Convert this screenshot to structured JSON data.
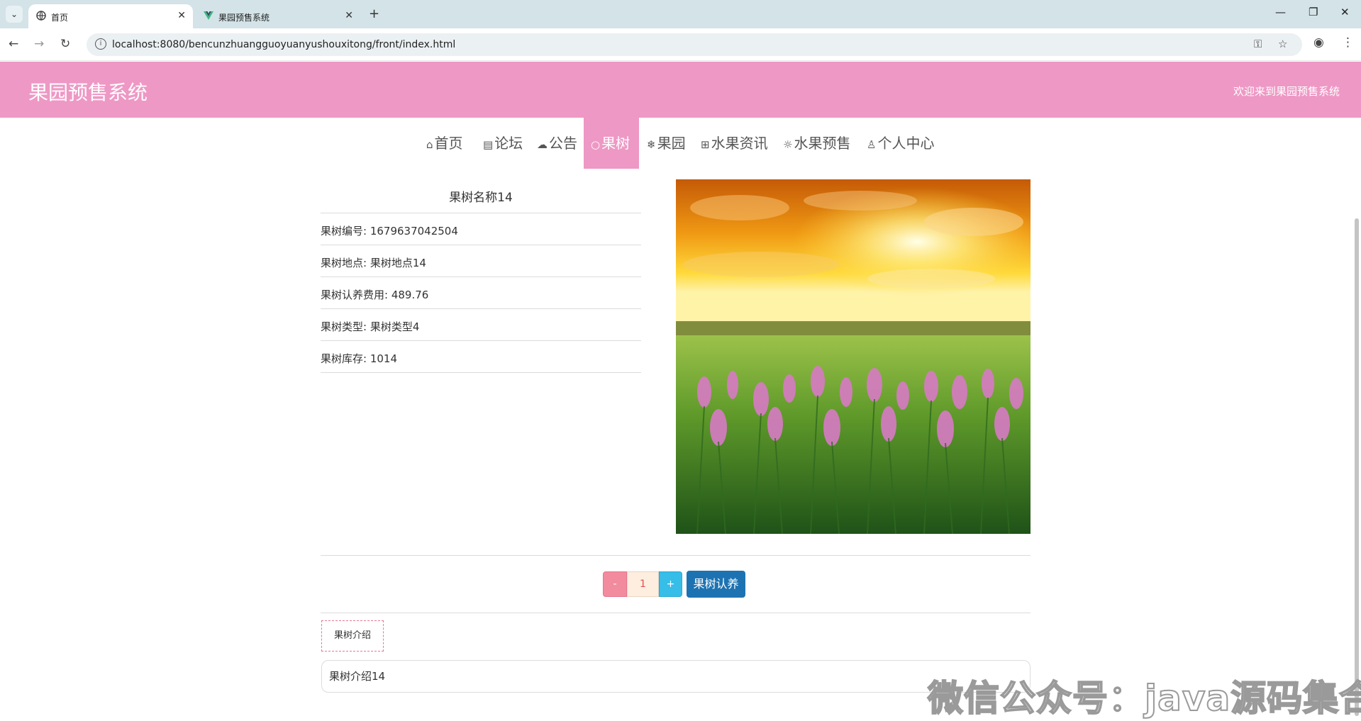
{
  "browser": {
    "tabs": [
      {
        "title": "首页",
        "icon": "globe-icon",
        "active": true
      },
      {
        "title": "果园预售系统",
        "icon": "vue-logo-icon",
        "active": false
      }
    ],
    "url": "localhost:8080/bencunzhuangguoyuanyushouxitong/front/index.html"
  },
  "header": {
    "title": "果园预售系统",
    "welcome": "欢迎来到果园预售系统"
  },
  "nav": {
    "items": [
      {
        "label": "首页",
        "icon": "home-icon"
      },
      {
        "label": "论坛",
        "icon": "calendar-icon"
      },
      {
        "label": "公告",
        "icon": "palette-icon"
      },
      {
        "label": "果树",
        "icon": "circle-icon",
        "active": true
      },
      {
        "label": "果园",
        "icon": "snowflake-icon"
      },
      {
        "label": "水果资讯",
        "icon": "gift-icon"
      },
      {
        "label": "水果预售",
        "icon": "sun-icon"
      },
      {
        "label": "个人中心",
        "icon": "user-icon"
      }
    ]
  },
  "detail": {
    "name": "果树名称14",
    "rows": [
      "果树编号: 1679637042504",
      "果树地点: 果树地点14",
      "果树认养费用: 489.76",
      "果树类型: 果树类型4",
      "果树库存: 1014"
    ]
  },
  "quantity": {
    "minus": "-",
    "value": "1",
    "plus": "+"
  },
  "adopt_button": "果树认养",
  "intro": {
    "tab_label": "果树介绍",
    "content": "果树介绍14"
  },
  "watermark": "微信公众号：java源码集合",
  "colors": {
    "brand_pink": "#ee98c5",
    "adopt_blue": "#1d73b2",
    "minus_red": "#f28b9e",
    "plus_cyan": "#36bde8"
  }
}
